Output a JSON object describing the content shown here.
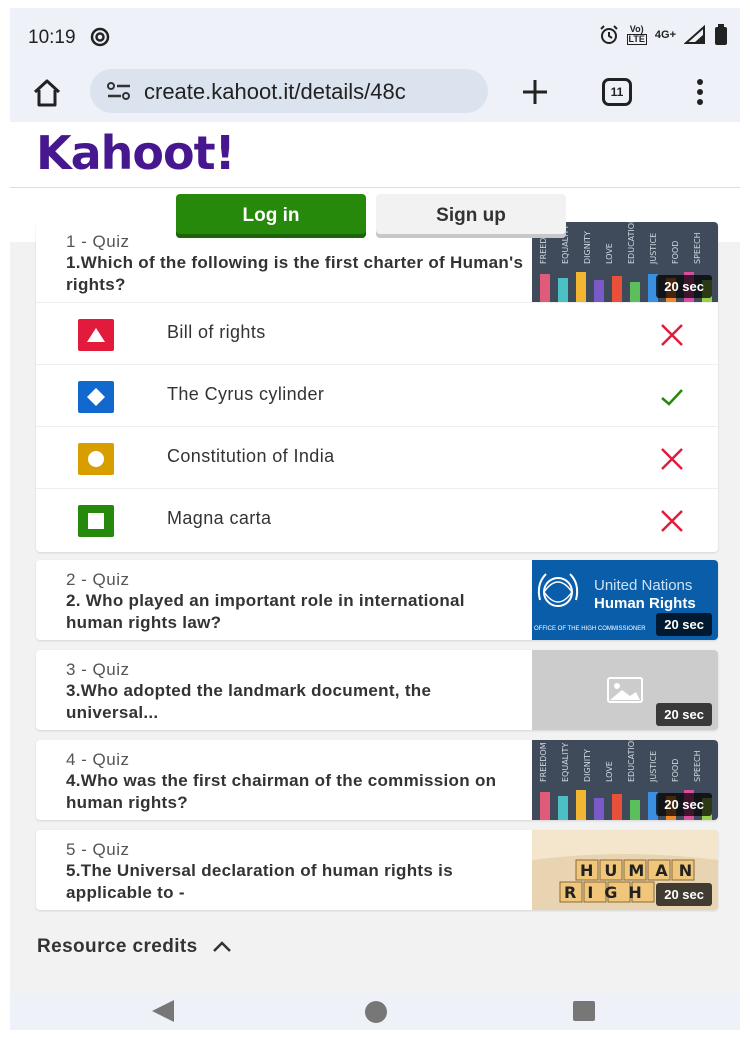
{
  "status_bar": {
    "time": "10:19",
    "network": "4G+",
    "lte_top": "Vo)",
    "lte_bottom": "LTE"
  },
  "browser": {
    "url": "create.kahoot.it/details/48c",
    "tab_count": "11"
  },
  "header": {
    "logo": "Kahoot!",
    "logo_color": "#46178f"
  },
  "auth": {
    "login_label": "Log in",
    "signup_label": "Sign up",
    "login_color": "#26890c"
  },
  "questions": [
    {
      "label": "1 - Quiz",
      "text": "1.Which of the following is the first charter of Human's rights?",
      "time": "20 sec",
      "answers": [
        {
          "text": "Bill of rights",
          "shape": "triangle-icon",
          "color": "#e21b3c",
          "correct": false
        },
        {
          "text": "The Cyrus cylinder",
          "shape": "diamond-icon",
          "color": "#1368ce",
          "correct": true
        },
        {
          "text": "Constitution of India",
          "shape": "circle-icon",
          "color": "#d89e00",
          "correct": false
        },
        {
          "text": "Magna carta",
          "shape": "square-icon",
          "color": "#26890c",
          "correct": false
        }
      ]
    },
    {
      "label": "2 - Quiz",
      "text": "2. Who played an important role in international human rights law?",
      "time": "20 sec",
      "thumb": {
        "line1": "United Nations",
        "line2": "Human Rights",
        "line3": "OFFICE OF THE HIGH COMMISSIONER"
      }
    },
    {
      "label": "3 - Quiz",
      "text": "3.Who adopted the landmark document, the universal...",
      "time": "20 sec"
    },
    {
      "label": "4 - Quiz",
      "text": "4.Who was the first chairman of the commission on human rights?",
      "time": "20 sec"
    },
    {
      "label": "5 - Quiz",
      "text": "5.The Universal declaration of human rights is applicable to -",
      "time": "20 sec",
      "thumb": {
        "row1": "HUMAN",
        "row2": "RIGH"
      }
    }
  ],
  "thumb_words": [
    "FREEDOM",
    "EQUALITY",
    "DIGNITY",
    "LOVE",
    "EDUCATION",
    "JUSTICE",
    "FOOD",
    "SPEECH"
  ],
  "resource_credits": "Resource credits",
  "colors": {
    "wrong": "#e21b3c",
    "correct": "#26890c"
  }
}
